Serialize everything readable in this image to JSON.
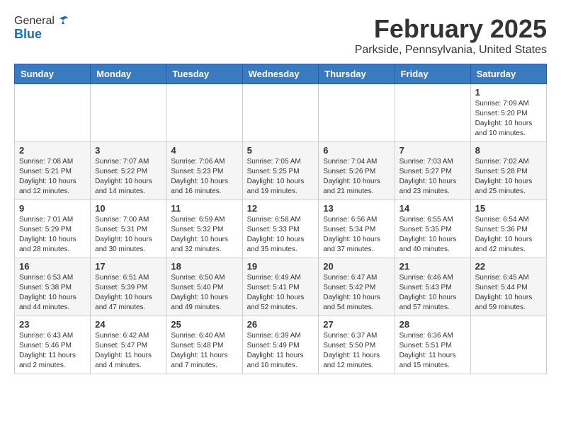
{
  "header": {
    "logo_general": "General",
    "logo_blue": "Blue",
    "title": "February 2025",
    "subtitle": "Parkside, Pennsylvania, United States"
  },
  "weekdays": [
    "Sunday",
    "Monday",
    "Tuesday",
    "Wednesday",
    "Thursday",
    "Friday",
    "Saturday"
  ],
  "weeks": [
    [
      {
        "day": "",
        "info": ""
      },
      {
        "day": "",
        "info": ""
      },
      {
        "day": "",
        "info": ""
      },
      {
        "day": "",
        "info": ""
      },
      {
        "day": "",
        "info": ""
      },
      {
        "day": "",
        "info": ""
      },
      {
        "day": "1",
        "info": "Sunrise: 7:09 AM\nSunset: 5:20 PM\nDaylight: 10 hours\nand 10 minutes."
      }
    ],
    [
      {
        "day": "2",
        "info": "Sunrise: 7:08 AM\nSunset: 5:21 PM\nDaylight: 10 hours\nand 12 minutes."
      },
      {
        "day": "3",
        "info": "Sunrise: 7:07 AM\nSunset: 5:22 PM\nDaylight: 10 hours\nand 14 minutes."
      },
      {
        "day": "4",
        "info": "Sunrise: 7:06 AM\nSunset: 5:23 PM\nDaylight: 10 hours\nand 16 minutes."
      },
      {
        "day": "5",
        "info": "Sunrise: 7:05 AM\nSunset: 5:25 PM\nDaylight: 10 hours\nand 19 minutes."
      },
      {
        "day": "6",
        "info": "Sunrise: 7:04 AM\nSunset: 5:26 PM\nDaylight: 10 hours\nand 21 minutes."
      },
      {
        "day": "7",
        "info": "Sunrise: 7:03 AM\nSunset: 5:27 PM\nDaylight: 10 hours\nand 23 minutes."
      },
      {
        "day": "8",
        "info": "Sunrise: 7:02 AM\nSunset: 5:28 PM\nDaylight: 10 hours\nand 25 minutes."
      }
    ],
    [
      {
        "day": "9",
        "info": "Sunrise: 7:01 AM\nSunset: 5:29 PM\nDaylight: 10 hours\nand 28 minutes."
      },
      {
        "day": "10",
        "info": "Sunrise: 7:00 AM\nSunset: 5:31 PM\nDaylight: 10 hours\nand 30 minutes."
      },
      {
        "day": "11",
        "info": "Sunrise: 6:59 AM\nSunset: 5:32 PM\nDaylight: 10 hours\nand 32 minutes."
      },
      {
        "day": "12",
        "info": "Sunrise: 6:58 AM\nSunset: 5:33 PM\nDaylight: 10 hours\nand 35 minutes."
      },
      {
        "day": "13",
        "info": "Sunrise: 6:56 AM\nSunset: 5:34 PM\nDaylight: 10 hours\nand 37 minutes."
      },
      {
        "day": "14",
        "info": "Sunrise: 6:55 AM\nSunset: 5:35 PM\nDaylight: 10 hours\nand 40 minutes."
      },
      {
        "day": "15",
        "info": "Sunrise: 6:54 AM\nSunset: 5:36 PM\nDaylight: 10 hours\nand 42 minutes."
      }
    ],
    [
      {
        "day": "16",
        "info": "Sunrise: 6:53 AM\nSunset: 5:38 PM\nDaylight: 10 hours\nand 44 minutes."
      },
      {
        "day": "17",
        "info": "Sunrise: 6:51 AM\nSunset: 5:39 PM\nDaylight: 10 hours\nand 47 minutes."
      },
      {
        "day": "18",
        "info": "Sunrise: 6:50 AM\nSunset: 5:40 PM\nDaylight: 10 hours\nand 49 minutes."
      },
      {
        "day": "19",
        "info": "Sunrise: 6:49 AM\nSunset: 5:41 PM\nDaylight: 10 hours\nand 52 minutes."
      },
      {
        "day": "20",
        "info": "Sunrise: 6:47 AM\nSunset: 5:42 PM\nDaylight: 10 hours\nand 54 minutes."
      },
      {
        "day": "21",
        "info": "Sunrise: 6:46 AM\nSunset: 5:43 PM\nDaylight: 10 hours\nand 57 minutes."
      },
      {
        "day": "22",
        "info": "Sunrise: 6:45 AM\nSunset: 5:44 PM\nDaylight: 10 hours\nand 59 minutes."
      }
    ],
    [
      {
        "day": "23",
        "info": "Sunrise: 6:43 AM\nSunset: 5:46 PM\nDaylight: 11 hours\nand 2 minutes."
      },
      {
        "day": "24",
        "info": "Sunrise: 6:42 AM\nSunset: 5:47 PM\nDaylight: 11 hours\nand 4 minutes."
      },
      {
        "day": "25",
        "info": "Sunrise: 6:40 AM\nSunset: 5:48 PM\nDaylight: 11 hours\nand 7 minutes."
      },
      {
        "day": "26",
        "info": "Sunrise: 6:39 AM\nSunset: 5:49 PM\nDaylight: 11 hours\nand 10 minutes."
      },
      {
        "day": "27",
        "info": "Sunrise: 6:37 AM\nSunset: 5:50 PM\nDaylight: 11 hours\nand 12 minutes."
      },
      {
        "day": "28",
        "info": "Sunrise: 6:36 AM\nSunset: 5:51 PM\nDaylight: 11 hours\nand 15 minutes."
      },
      {
        "day": "",
        "info": ""
      }
    ]
  ]
}
